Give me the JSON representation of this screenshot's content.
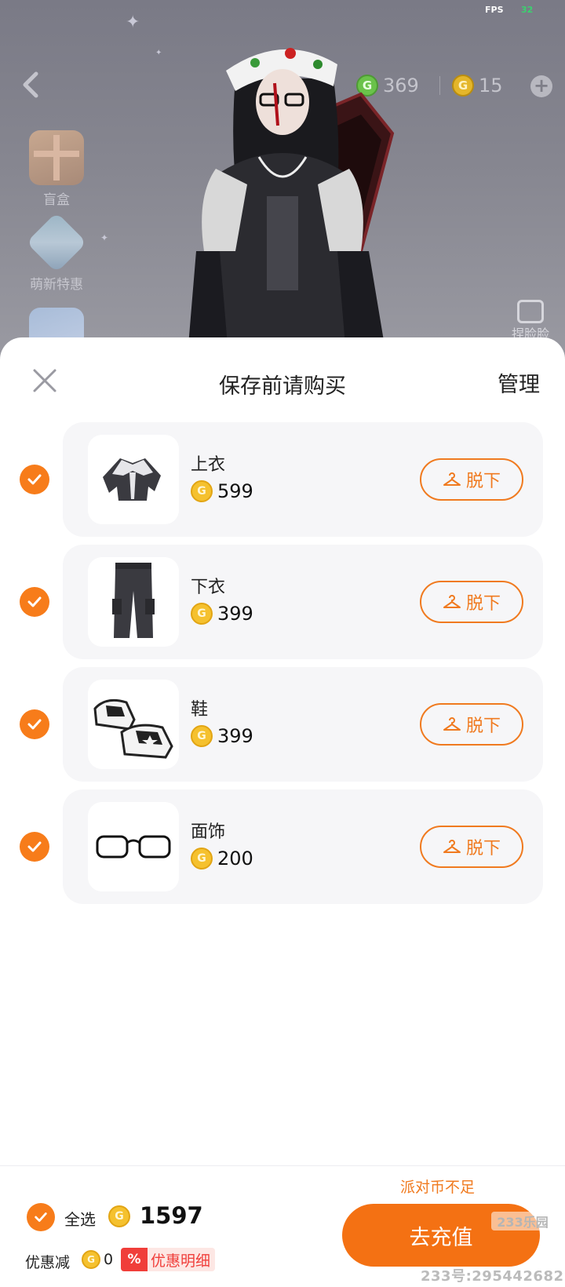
{
  "status": {
    "fps_label": "FPS",
    "fps_value": "32"
  },
  "top_bar": {
    "currency_g": {
      "icon": "g-coin-green-icon",
      "value": "369",
      "color": "#6ac24a"
    },
    "currency_c": {
      "icon": "g-coin-gold-icon",
      "value": "15",
      "color": "#e4b62a"
    },
    "add_icon": "plus-circle-icon"
  },
  "side_menu": {
    "items": [
      {
        "label": "盲盒",
        "icon": "gift-box-icon"
      },
      {
        "label": "萌新特惠",
        "icon": "newbie-deal-icon"
      },
      {
        "label": "",
        "icon": "cube-box-icon"
      }
    ],
    "pinch_face_label": "捏脸脸"
  },
  "sheet": {
    "title": "保存前请购买",
    "manage_label": "管理",
    "items": [
      {
        "name": "上衣",
        "price": "599",
        "action_label": "脱下",
        "thumb": "jacket-icon"
      },
      {
        "name": "下衣",
        "price": "399",
        "action_label": "脱下",
        "thumb": "pants-icon"
      },
      {
        "name": "鞋",
        "price": "399",
        "action_label": "脱下",
        "thumb": "sneakers-icon"
      },
      {
        "name": "面饰",
        "price": "200",
        "action_label": "脱下",
        "thumb": "glasses-icon"
      }
    ]
  },
  "footer": {
    "insufficient_label": "派对币不足",
    "select_all_label": "全选",
    "total": "1597",
    "discount_label": "优惠减",
    "discount_value": "0",
    "discount_tag": "%",
    "discount_detail_label": "优惠明细",
    "recharge_label": "去充值"
  },
  "watermark": {
    "logo": "233乐园",
    "id_text": "233号:295442682"
  },
  "colors": {
    "accent": "#f47113",
    "coin": "#f5c12e",
    "discount_red": "#f03e3a"
  }
}
